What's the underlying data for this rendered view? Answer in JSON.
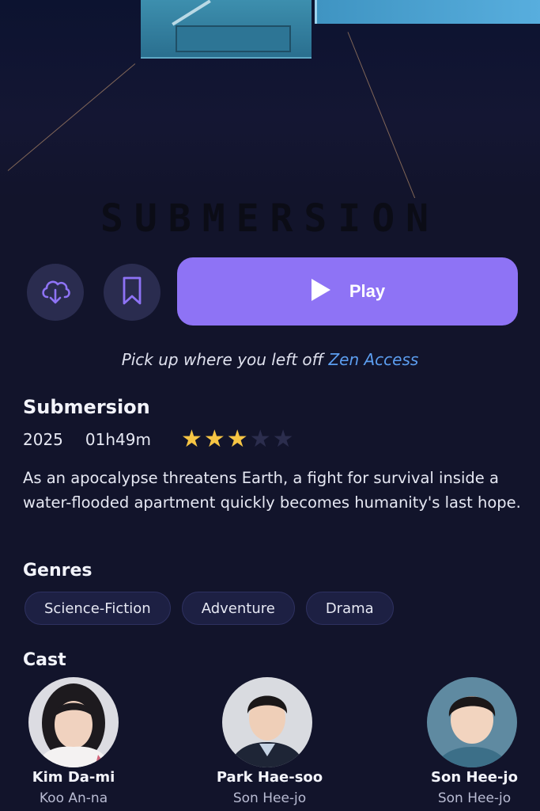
{
  "title": "SUBMERSION",
  "actions": {
    "download_icon": "cloud-download-icon",
    "bookmark_icon": "bookmark-icon",
    "play_label": "Play",
    "play_icon": "play-icon"
  },
  "resume": {
    "text": "Pick up where you left off",
    "accent": "Zen Access",
    "accent_color": "#5c9ef0"
  },
  "movie": {
    "name": "Submersion",
    "year": "2025",
    "runtime": "01h49m",
    "rating": 3,
    "rating_max": 5,
    "description": "As an apocalypse threatens Earth, a fight for survival inside a water-flooded apartment quickly becomes humanity's last hope."
  },
  "genres": {
    "heading": "Genres",
    "items": [
      "Science-Fiction",
      "Adventure",
      "Drama"
    ]
  },
  "cast": {
    "heading": "Cast",
    "members": [
      {
        "name": "Kim Da-mi",
        "role": "Koo An-na"
      },
      {
        "name": "Park Hae-soo",
        "role": "Son Hee-jo"
      },
      {
        "name": "Son Hee-jo",
        "role": "Son Hee-jo"
      }
    ]
  },
  "colors": {
    "background": "#12142b",
    "accent": "#8e73f5",
    "star_filled": "#f6c544",
    "star_empty": "#2b2d4d"
  }
}
